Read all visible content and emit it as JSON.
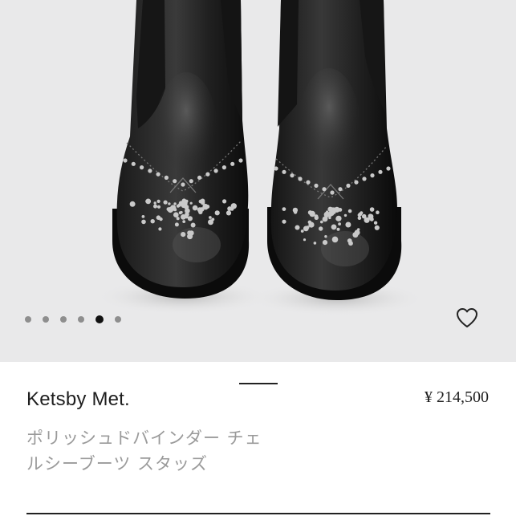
{
  "product": {
    "brand": "Ketsby Met.",
    "price": "¥ 214,500",
    "name_line1": "ポリッシュドバインダー チェ",
    "name_line2": "ルシーブーツ スタッズ"
  },
  "gallery": {
    "image_subject": "black studded chelsea boots",
    "dots_count": 6,
    "active_dot_index": 4
  },
  "icons": {
    "favorite": "heart-outline-icon"
  },
  "colors": {
    "hero_background": "#e9e9ea",
    "text_primary": "#1e1e1e",
    "text_secondary": "#9a9a9a",
    "dot_inactive": "#8e8e8e",
    "dot_active": "#111111"
  }
}
